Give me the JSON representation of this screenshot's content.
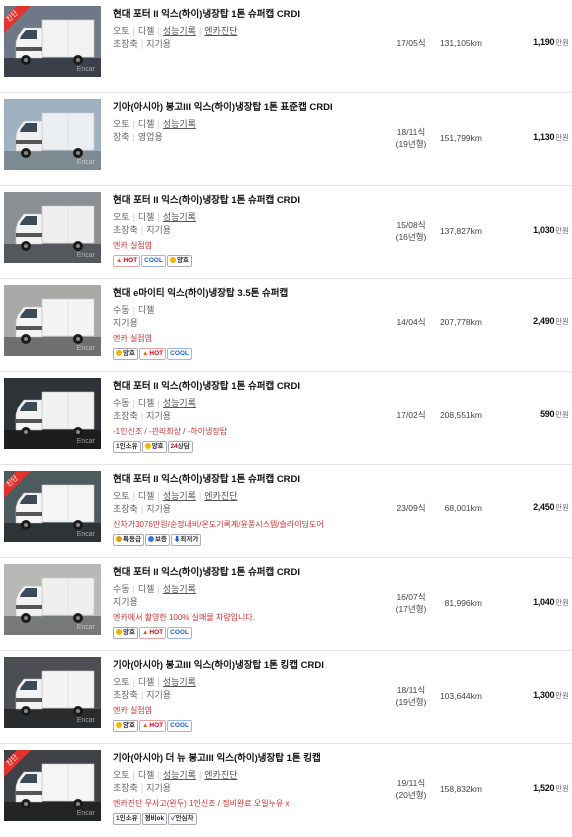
{
  "listings": [
    {
      "title": "현대 포터 II 익스(하이)냉장탑 1톤 슈퍼캡 CRDI",
      "spec_parts": [
        "오토",
        "디젤",
        "성능기록",
        "엔카진단"
      ],
      "spec_links": [
        false,
        false,
        true,
        true
      ],
      "tags": [
        "초장축",
        "지기용"
      ],
      "note": "",
      "badges": [],
      "year": "17/05식",
      "year_sub": "",
      "km": "131,105km",
      "price": "1,190",
      "price_unit": "만원",
      "ribbon": "진단",
      "photo": {
        "bg": "#6f7886",
        "ground": "#3b3f47",
        "box": "#f2f2f2",
        "cab": "#f4f4f4"
      }
    },
    {
      "title": "기아(아시아) 봉고III 익스(하이)냉장탑 1톤 표준캡 CRDI",
      "spec_parts": [
        "오토",
        "디젤",
        "성능기록"
      ],
      "spec_links": [
        false,
        false,
        true
      ],
      "tags": [
        "장축",
        "영업용"
      ],
      "note": "",
      "badges": [],
      "year": "18/11식",
      "year_sub": "(19년형)",
      "km": "151,799km",
      "price": "1,130",
      "price_unit": "만원",
      "ribbon": "",
      "photo": {
        "bg": "#9fb2c2",
        "ground": "#7e8a92",
        "box": "#eceff2",
        "cab": "#f0f0f0"
      }
    },
    {
      "title": "현대 포터 II 익스(하이)냉장탑 1톤 슈퍼캡 CRDI",
      "spec_parts": [
        "오토",
        "디젤",
        "성능기록"
      ],
      "spec_links": [
        false,
        false,
        true
      ],
      "tags": [
        "초장축",
        "지기용"
      ],
      "note": "엔카 실점염",
      "badges": [
        "hot",
        "cool",
        "good"
      ],
      "year": "15/08식",
      "year_sub": "(16년형)",
      "km": "137,827km",
      "price": "1,030",
      "price_unit": "만원",
      "ribbon": "",
      "photo": {
        "bg": "#8a8f94",
        "ground": "#54585c",
        "box": "#efefef",
        "cab": "#f2f2f2"
      }
    },
    {
      "title": "현대 e마이티 익스(하이)냉장탑 3.5톤 슈퍼캡",
      "spec_parts": [
        "수동",
        "디젤"
      ],
      "spec_links": [
        false,
        false
      ],
      "tags": [
        "지기용"
      ],
      "note": "엔카 실점염",
      "badges": [
        "good",
        "hot",
        "cool"
      ],
      "year": "14/04식",
      "year_sub": "",
      "km": "207,778km",
      "price": "2,490",
      "price_unit": "만원",
      "ribbon": "",
      "photo": {
        "bg": "#a9aaa8",
        "ground": "#6e706e",
        "box": "#f4f4f4",
        "cab": "#f4f4f4"
      }
    },
    {
      "title": "현대 포터 II 익스(하이)냉장탑 1톤 슈퍼캡 CRDI",
      "spec_parts": [
        "수동",
        "디젤",
        "성능기록"
      ],
      "spec_links": [
        false,
        false,
        true
      ],
      "tags": [
        "초장축",
        "지기용"
      ],
      "note": "-1인신조 / -관리최상 / -하이냉장탑",
      "badges": [
        "single",
        "good",
        "24"
      ],
      "year": "17/02식",
      "year_sub": "",
      "km": "208,551km",
      "price": "590",
      "price_unit": "만원",
      "ribbon": "",
      "photo": {
        "bg": "#2f3236",
        "ground": "#1c1d1f",
        "box": "#f1f1f1",
        "cab": "#f3f3f3"
      }
    },
    {
      "title": "현대 포터 II 익스(하이)냉장탑 1톤 슈퍼캡 CRDI",
      "spec_parts": [
        "오토",
        "디젤",
        "성능기록",
        "엔카진단"
      ],
      "spec_links": [
        false,
        false,
        true,
        true
      ],
      "tags": [
        "초장축",
        "지기용"
      ],
      "note": "신차가3076만원/순정내비/온도기록계/윤풍시스템/슬라이딩도어",
      "badges": [
        "special",
        "warranty",
        "lowest"
      ],
      "year": "23/09식",
      "year_sub": "",
      "km": "68,001km",
      "price": "2,450",
      "price_unit": "만원",
      "ribbon": "진단",
      "photo": {
        "bg": "#4d5a5e",
        "ground": "#2e3436",
        "box": "#f6f6f6",
        "cab": "#f6f6f6"
      }
    },
    {
      "title": "현대 포터 II 익스(하이)냉장탑 1톤 슈퍼캡 CRDI",
      "spec_parts": [
        "수동",
        "디젤",
        "성능기록"
      ],
      "spec_links": [
        false,
        false,
        true
      ],
      "tags": [
        "지기용"
      ],
      "note": "엔카에서 촬영한 100% 실매물 차량입니다.",
      "badges": [
        "good",
        "hot",
        "cool"
      ],
      "year": "16/07식",
      "year_sub": "(17년형)",
      "km": "81,996km",
      "price": "1,040",
      "price_unit": "만원",
      "ribbon": "",
      "photo": {
        "bg": "#b7b9b6",
        "ground": "#777a77",
        "box": "#efefee",
        "cab": "#f2f2f2"
      }
    },
    {
      "title": "기아(아시아) 봉고III 익스(하이)냉장탑 1톤 킹캡 CRDI",
      "spec_parts": [
        "오토",
        "디젤",
        "성능기록"
      ],
      "spec_links": [
        false,
        false,
        true
      ],
      "tags": [
        "초장축",
        "지기용"
      ],
      "note": "엔카 실점염",
      "badges": [
        "good",
        "hot",
        "cool"
      ],
      "year": "18/11식",
      "year_sub": "(19년형)",
      "km": "103,644km",
      "price": "1,300",
      "price_unit": "만원",
      "ribbon": "",
      "photo": {
        "bg": "#4b4f53",
        "ground": "#2a2c2e",
        "box": "#f4f4f4",
        "cab": "#f4f4f4"
      }
    },
    {
      "title": "기아(아시아) 더 뉴 봉고III 익스(하이)냉장탑 1톤 킹캡",
      "spec_parts": [
        "오토",
        "디젤",
        "성능기록",
        "엔카진단"
      ],
      "spec_links": [
        false,
        false,
        true,
        true
      ],
      "tags": [
        "초장축",
        "지기용"
      ],
      "note": "엔카진단 무사고(완두) 1인신조 / 정비완료 오일누유 x",
      "badges": [
        "single",
        "ok",
        "assured"
      ],
      "year": "19/11식",
      "year_sub": "(20년형)",
      "km": "158,832km",
      "price": "1,520",
      "price_unit": "만원",
      "ribbon": "진단",
      "photo": {
        "bg": "#3e4246",
        "ground": "#222426",
        "box": "#f5f5f5",
        "cab": "#f5f5f5"
      }
    }
  ],
  "badge_labels": {
    "hot": "HOT",
    "cool": "COOL",
    "good": "양호",
    "single": "1인소유",
    "24": "상담",
    "24_num": "24",
    "special": "특등급",
    "warranty": "보증",
    "lowest": "최저가",
    "ok": "정비ok",
    "assured": "안심차"
  },
  "watermark": "Encar"
}
